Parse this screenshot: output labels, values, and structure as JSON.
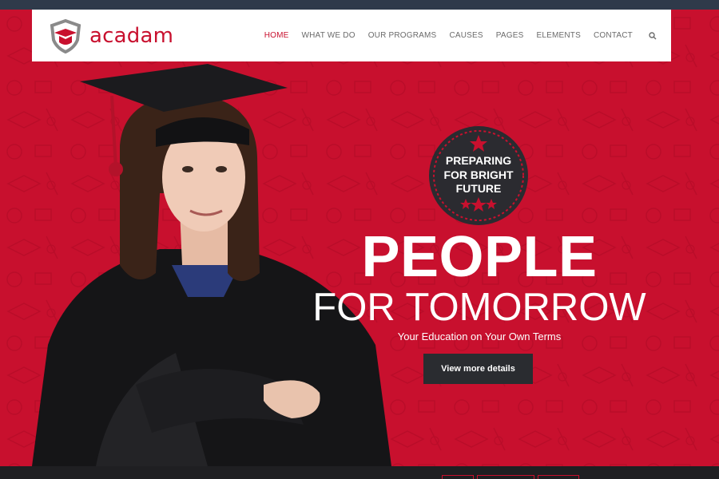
{
  "brand": {
    "name": "acadam",
    "accent": "#c8102e",
    "dark": "#2a2c30"
  },
  "nav": {
    "items": [
      {
        "label": "HOME",
        "active": true
      },
      {
        "label": "WHAT WE DO"
      },
      {
        "label": "OUR PROGRAMS"
      },
      {
        "label": "CAUSES"
      },
      {
        "label": "PAGES"
      },
      {
        "label": "ELEMENTS"
      },
      {
        "label": "CONTACT"
      }
    ],
    "search_icon": "search-icon"
  },
  "hero": {
    "badge_lines": [
      "PREPARING",
      "FOR BRIGHT",
      "FUTURE"
    ],
    "title": "PEOPLE",
    "subtitle": "FOR TOMORROW",
    "tagline": "Your Education on Your Own Terms",
    "cta_label": "View more details"
  }
}
